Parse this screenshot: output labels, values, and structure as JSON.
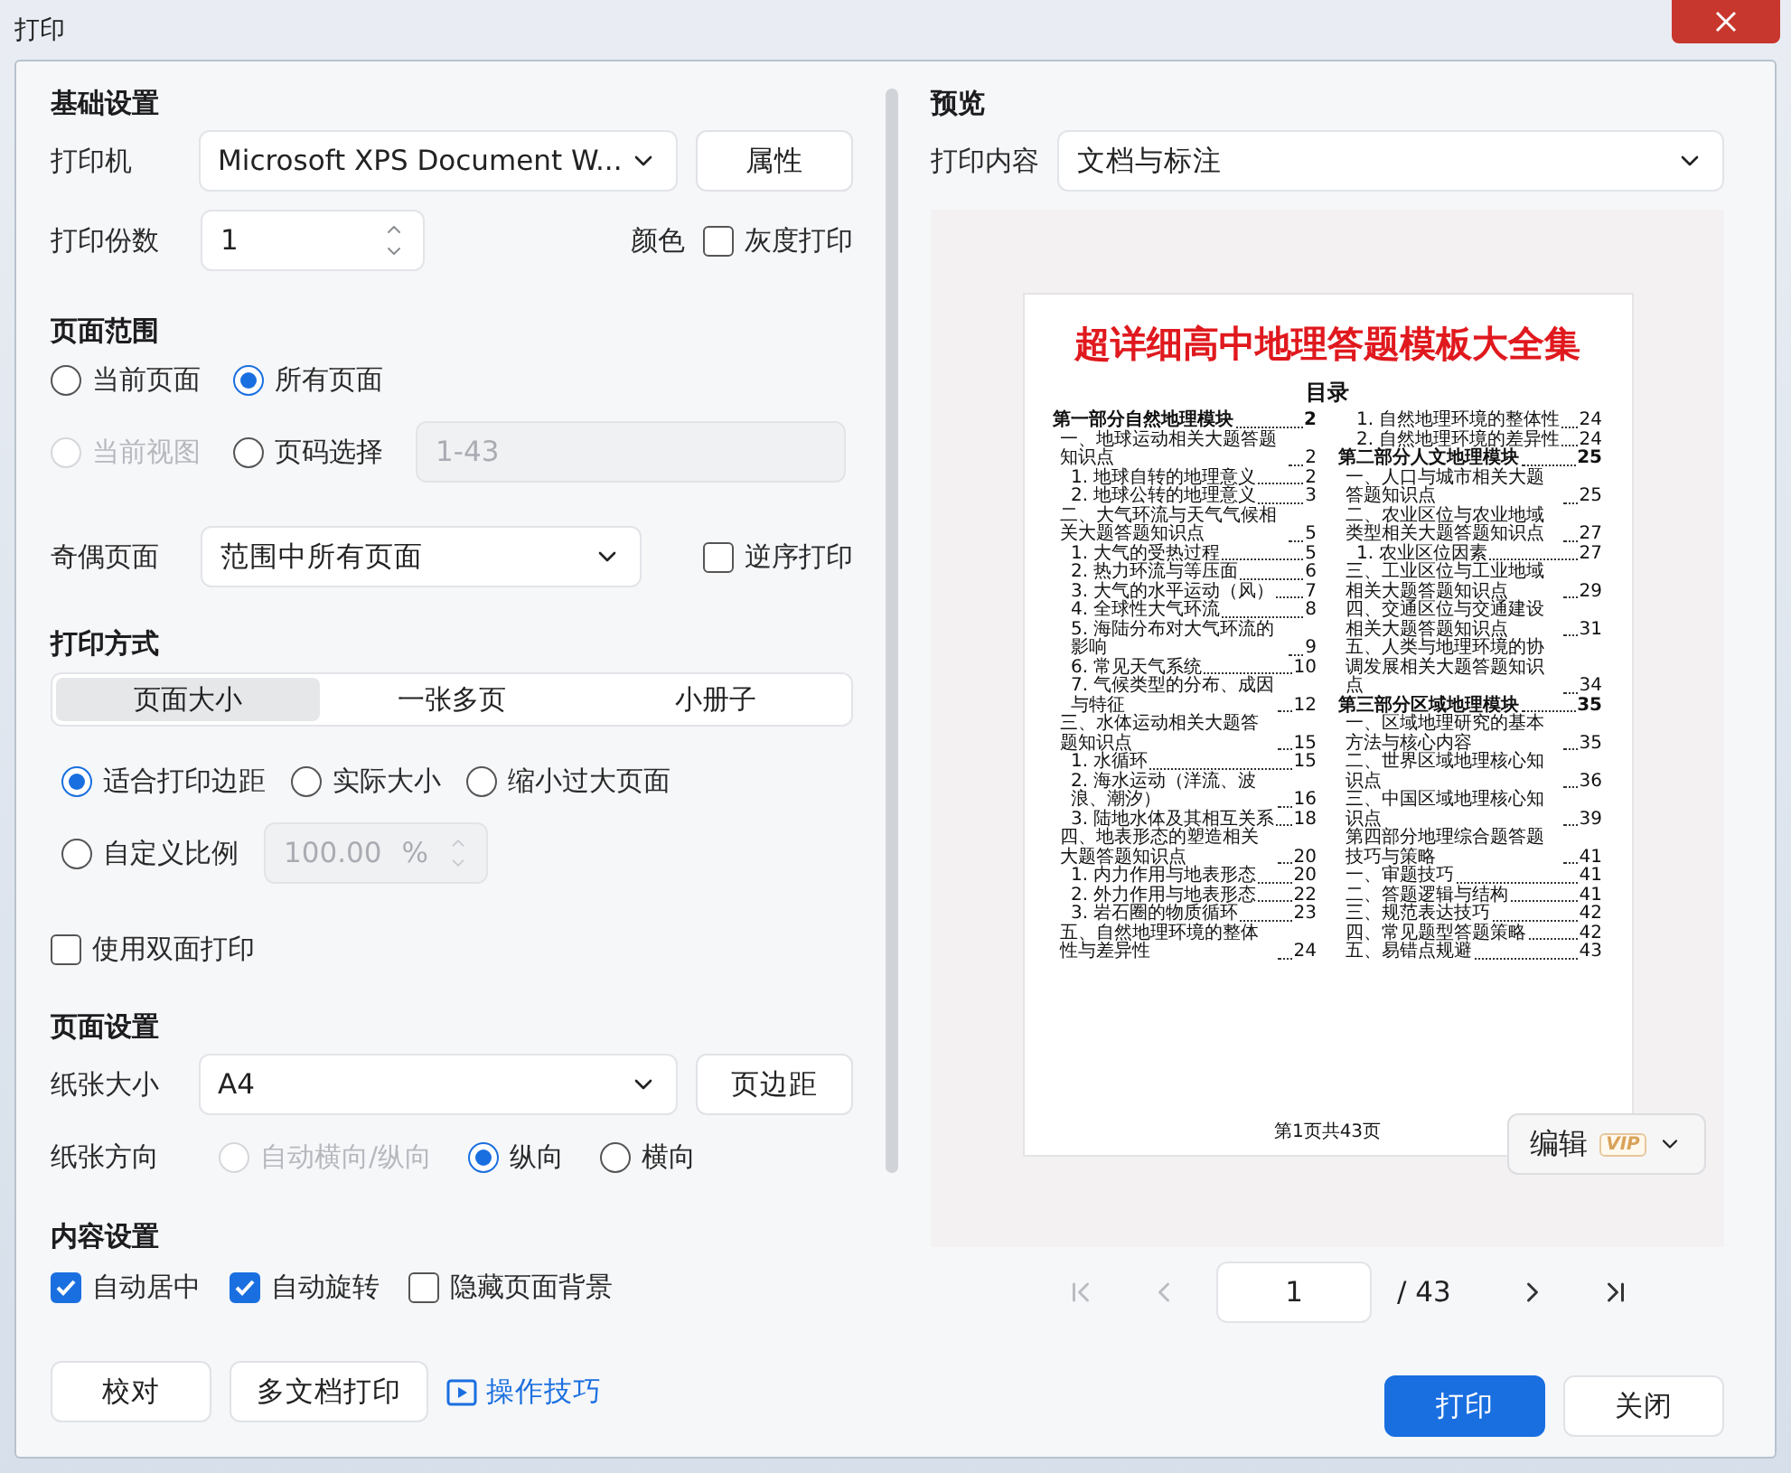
{
  "window": {
    "title": "打印"
  },
  "basic": {
    "heading": "基础设置",
    "printer_label": "打印机",
    "printer": "Microsoft XPS Document W...",
    "properties_button": "属性",
    "copies_label": "打印份数",
    "copies": "1",
    "color_label": "颜色",
    "grayscale": {
      "label": "灰度打印",
      "checked": false
    }
  },
  "page_range": {
    "heading": "页面范围",
    "options": [
      {
        "label": "当前页面",
        "selected": false,
        "disabled": false
      },
      {
        "label": "所有页面",
        "selected": true,
        "disabled": false
      },
      {
        "label": "当前视图",
        "selected": false,
        "disabled": true
      },
      {
        "label": "页码选择",
        "selected": false,
        "disabled": false
      }
    ],
    "pages_field": {
      "value": "1-43",
      "disabled": true
    }
  },
  "odd_even": {
    "label": "奇偶页面",
    "value": "范围中所有页面",
    "reverse": {
      "label": "逆序打印",
      "checked": false
    }
  },
  "print_mode": {
    "heading": "打印方式",
    "tabs": [
      {
        "label": "页面大小",
        "selected": true
      },
      {
        "label": "一张多页",
        "selected": false
      },
      {
        "label": "小册子",
        "selected": false
      }
    ],
    "scale_options": [
      {
        "label": "适合打印边距",
        "selected": true
      },
      {
        "label": "实际大小",
        "selected": false
      },
      {
        "label": "缩小过大页面",
        "selected": false
      }
    ],
    "custom_scale": {
      "label": "自定义比例",
      "selected": false,
      "value": "100.00",
      "unit": "%",
      "disabled": true
    }
  },
  "duplex": {
    "label": "使用双面打印",
    "checked": false
  },
  "page_setup": {
    "heading": "页面设置",
    "paper_label": "纸张大小",
    "paper": "A4",
    "margins_button": "页边距",
    "orientation_label": "纸张方向",
    "orientations": [
      {
        "label": "自动横向/纵向",
        "selected": false,
        "disabled": true
      },
      {
        "label": "纵向",
        "selected": true,
        "disabled": false
      },
      {
        "label": "横向",
        "selected": false,
        "disabled": false
      }
    ]
  },
  "content": {
    "heading": "内容设置",
    "options": [
      {
        "label": "自动居中",
        "checked": true
      },
      {
        "label": "自动旋转",
        "checked": true
      },
      {
        "label": "隐藏页面背景",
        "checked": false
      }
    ]
  },
  "footer_buttons": [
    "校对",
    "多文档打印"
  ],
  "tips_link": "操作技巧",
  "preview": {
    "heading": "预览",
    "content_label": "打印内容",
    "content": "文档与标注",
    "document": {
      "title": "超详细高中地理答题模板大全集",
      "toc_heading": "目录",
      "footer": "第1页共43页",
      "columns": [
        [
          {
            "kind": "part",
            "text": "第一部分自然地理模块",
            "page": "2"
          },
          {
            "kind": "section",
            "text": "一、地球运动相关大题答题知识点",
            "page": "2"
          },
          {
            "kind": "item",
            "text": "1. 地球自转的地理意义",
            "page": "2"
          },
          {
            "kind": "item",
            "text": "2. 地球公转的地理意义",
            "page": "3"
          },
          {
            "kind": "section",
            "text": "二、大气环流与天气气候相关大题答题知识点",
            "page": "5"
          },
          {
            "kind": "item",
            "text": "1. 大气的受热过程",
            "page": "5"
          },
          {
            "kind": "item",
            "text": "2. 热力环流与等压面",
            "page": "6"
          },
          {
            "kind": "item",
            "text": "3. 大气的水平运动（风）",
            "page": "7"
          },
          {
            "kind": "item",
            "text": "4. 全球性大气环流",
            "page": "8"
          },
          {
            "kind": "item",
            "text": "5. 海陆分布对大气环流的影响",
            "page": "9"
          },
          {
            "kind": "item",
            "text": "6. 常见天气系统",
            "page": "10"
          },
          {
            "kind": "item",
            "text": "7. 气候类型的分布、成因与特征",
            "page": "12"
          },
          {
            "kind": "section",
            "text": "三、水体运动相关大题答题知识点",
            "page": "15"
          },
          {
            "kind": "item",
            "text": "1. 水循环",
            "page": "15"
          },
          {
            "kind": "item",
            "text": "2. 海水运动（洋流、波浪、潮汐）",
            "page": "16"
          },
          {
            "kind": "item",
            "text": "3. 陆地水体及其相互关系",
            "page": "18"
          },
          {
            "kind": "section",
            "text": "四、地表形态的塑造相关大题答题知识点",
            "page": "20"
          },
          {
            "kind": "item",
            "text": "1. 内力作用与地表形态",
            "page": "20"
          },
          {
            "kind": "item",
            "text": "2. 外力作用与地表形态",
            "page": "22"
          },
          {
            "kind": "item",
            "text": "3. 岩石圈的物质循环",
            "page": "23"
          },
          {
            "kind": "section",
            "text": "五、自然地理环境的整体性与差异性",
            "page": "24"
          }
        ],
        [
          {
            "kind": "item",
            "text": "1. 自然地理环境的整体性",
            "page": "24"
          },
          {
            "kind": "item",
            "text": "2. 自然地理环境的差异性",
            "page": "24"
          },
          {
            "kind": "part",
            "text": "第二部分人文地理模块",
            "page": "25"
          },
          {
            "kind": "section",
            "text": "一、人口与城市相关大题答题知识点",
            "page": "25"
          },
          {
            "kind": "section",
            "text": "二、农业区位与农业地域类型相关大题答题知识点",
            "page": "27"
          },
          {
            "kind": "item",
            "text": "1. 农业区位因素",
            "page": "27"
          },
          {
            "kind": "section",
            "text": "三、工业区位与工业地域相关大题答题知识点",
            "page": "29"
          },
          {
            "kind": "section",
            "text": "四、交通区位与交通建设相关大题答题知识点",
            "page": "31"
          },
          {
            "kind": "section",
            "text": "五、人类与地理环境的协调发展相关大题答题知识点",
            "page": "34"
          },
          {
            "kind": "part",
            "text": "第三部分区域地理模块",
            "page": "35"
          },
          {
            "kind": "section",
            "text": "一、区域地理研究的基本方法与核心内容",
            "page": "35"
          },
          {
            "kind": "section",
            "text": "二、世界区域地理核心知识点",
            "page": "36"
          },
          {
            "kind": "section",
            "text": "三、中国区域地理核心知识点",
            "page": "39"
          },
          {
            "kind": "section",
            "text": "第四部分地理综合题答题技巧与策略",
            "page": "41"
          },
          {
            "kind": "section",
            "text": "一、审题技巧",
            "page": "41"
          },
          {
            "kind": "section",
            "text": "二、答题逻辑与结构",
            "page": "41"
          },
          {
            "kind": "section",
            "text": "三、规范表达技巧",
            "page": "42"
          },
          {
            "kind": "section",
            "text": "四、常见题型答题策略",
            "page": "42"
          },
          {
            "kind": "section",
            "text": "五、易错点规避",
            "page": "43"
          }
        ]
      ]
    },
    "edit_button": {
      "label": "编辑",
      "badge": "VIP"
    },
    "pager": {
      "page": "1",
      "total": "/ 43"
    }
  },
  "actions": {
    "print": "打印",
    "close": "关闭"
  }
}
